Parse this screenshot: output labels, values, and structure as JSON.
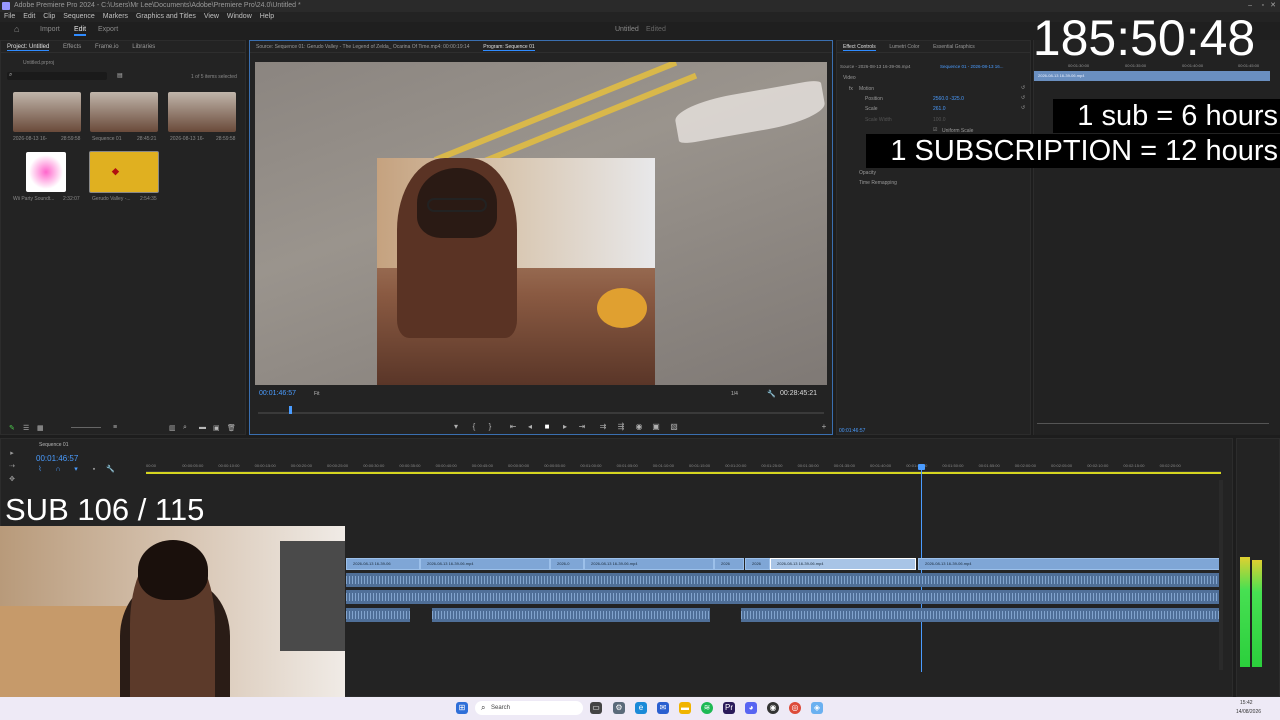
{
  "window_title": "Adobe Premiere Pro 2024 - C:\\Users\\Mr Lee\\Documents\\Adobe\\Premiere Pro\\24.0\\Untitled *",
  "menu": [
    "File",
    "Edit",
    "Clip",
    "Sequence",
    "Markers",
    "Graphics and Titles",
    "View",
    "Window",
    "Help"
  ],
  "workspace_tabs": [
    "Import",
    "Edit",
    "Export"
  ],
  "active_workspace": "Edit",
  "document_title": "Untitled",
  "document_state": "Edited",
  "project_panel": {
    "tabs": [
      "Project: Untitled",
      "Effects",
      "Frame.io",
      "Libraries"
    ],
    "file": "Untitled.prproj",
    "items_selected": "1 of 5 items selected",
    "items": [
      {
        "name": "2026-08-13 16-",
        "duration": "28:59:58"
      },
      {
        "name": "Sequence 01",
        "duration": "28:45:21"
      },
      {
        "name": "2026-08-13 16-",
        "duration": "28:59:58"
      },
      {
        "name": "Wii Party Soundt...",
        "duration": "2:32:07"
      },
      {
        "name": "Gerudo Valley -...",
        "duration": "2:54:35"
      }
    ]
  },
  "source_monitor": {
    "tab": "Source: Sequence 01: Gerudo Valley - The Legend of Zelda_ Ocarina Of Time.mp4: 00:00:19:14",
    "program_tab": "Program: Sequence 01"
  },
  "program_monitor": {
    "timecode": "00:01:46:57",
    "fit": "Fit",
    "resolution": "1/4",
    "duration": "00:28:45:21"
  },
  "effect_controls": {
    "tabs": [
      "Effect Controls",
      "Lumetri Color",
      "Essential Graphics"
    ],
    "source_label": "Source - 2026-08-13 16-39-06.mp4",
    "sequence_label": "Sequence 01 - 2026-08-13 16...",
    "section": "Video",
    "rows": [
      {
        "name": "Motion",
        "value": ""
      },
      {
        "name": "Position",
        "value": "2560.0    -325.0"
      },
      {
        "name": "Scale",
        "value": "261.0"
      },
      {
        "name": "Scale Width",
        "value": "100.0"
      },
      {
        "name": "Uniform Scale",
        "value": ""
      },
      {
        "name": "Opacity",
        "value": ""
      },
      {
        "name": "Time Remapping",
        "value": ""
      }
    ],
    "mini_clip": "2026-08-13 16-39-06.mp4",
    "ruler": [
      "00:01:30:00",
      "00:01:35:00",
      "00:01:40:00",
      "00:01:45:00"
    ],
    "timecode": "00:01:46:57"
  },
  "overlays": {
    "timer": "185:50:48",
    "sub_rule": "1 sub = 6 hours",
    "subscription_rule": "1 SUBSCRIPTION = 12 hours",
    "sub_counter": "SUB 106 / 115"
  },
  "timeline": {
    "sequence_tab": "Sequence 01",
    "timecode": "00:01:46:57",
    "ruler": [
      "00:00",
      "00:00:05:00",
      "00:00:10:00",
      "00:00:15:00",
      "00:00:20:00",
      "00:00:25:00",
      "00:00:30:00",
      "00:00:35:00",
      "00:00:40:00",
      "00:00:45:00",
      "00:00:50:00",
      "00:00:55:00",
      "00:01:00:00",
      "00:01:05:00",
      "00:01:10:00",
      "00:01:15:00",
      "00:01:20:00",
      "00:01:25:00",
      "00:01:30:00",
      "00:01:35:00",
      "00:01:40:00",
      "00:01:45:00",
      "00:01:50:00",
      "00:01:55:00",
      "00:02:00:00",
      "00:02:05:00",
      "00:02:10:00",
      "00:02:15:00",
      "00:02:20:00"
    ],
    "video_clips": [
      "2026-08-13 16-39-06",
      "2026-08-13 16-39-06.mp4",
      "2026-0",
      "2026-08-13 16-39-06.mp4",
      "2026",
      "2026",
      "2026-08-13 16-39-06.mp4",
      "2026-08-13 16-39-06.mp4"
    ]
  },
  "taskbar": {
    "search_placeholder": "Search",
    "time": "15:42",
    "date": "14/08/2026"
  }
}
